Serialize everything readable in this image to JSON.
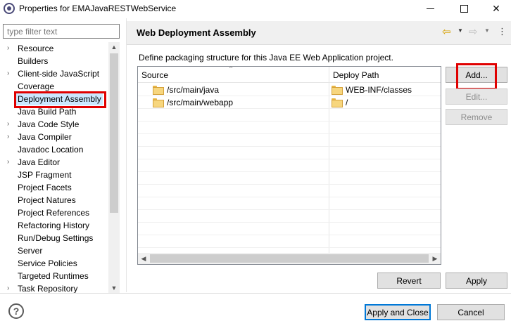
{
  "window": {
    "title": "Properties for EMAJavaRESTWebService",
    "icon": "eclipse-icon"
  },
  "filter": {
    "placeholder": "type filter text"
  },
  "tree": {
    "items": [
      {
        "label": "Resource",
        "expandable": true
      },
      {
        "label": "Builders",
        "expandable": false
      },
      {
        "label": "Client-side JavaScript",
        "expandable": true
      },
      {
        "label": "Coverage",
        "expandable": false
      },
      {
        "label": "Deployment Assembly",
        "expandable": false,
        "selected": true
      },
      {
        "label": "Java Build Path",
        "expandable": false
      },
      {
        "label": "Java Code Style",
        "expandable": true
      },
      {
        "label": "Java Compiler",
        "expandable": true
      },
      {
        "label": "Javadoc Location",
        "expandable": false
      },
      {
        "label": "Java Editor",
        "expandable": true
      },
      {
        "label": "JSP Fragment",
        "expandable": false
      },
      {
        "label": "Project Facets",
        "expandable": false
      },
      {
        "label": "Project Natures",
        "expandable": false
      },
      {
        "label": "Project References",
        "expandable": false
      },
      {
        "label": "Refactoring History",
        "expandable": false
      },
      {
        "label": "Run/Debug Settings",
        "expandable": false
      },
      {
        "label": "Server",
        "expandable": false
      },
      {
        "label": "Service Policies",
        "expandable": false
      },
      {
        "label": "Targeted Runtimes",
        "expandable": false
      },
      {
        "label": "Task Repository",
        "expandable": true
      }
    ]
  },
  "page": {
    "title": "Web Deployment Assembly",
    "description": "Define packaging structure for this Java EE Web Application project."
  },
  "table": {
    "columns": [
      "Source",
      "Deploy Path"
    ],
    "rows": [
      {
        "source": "/src/main/java",
        "deploy": "WEB-INF/classes"
      },
      {
        "source": "/src/main/webapp",
        "deploy": "/"
      }
    ]
  },
  "buttons": {
    "add": "Add...",
    "edit": "Edit...",
    "remove": "Remove",
    "revert": "Revert",
    "apply": "Apply",
    "apply_close": "Apply and Close",
    "cancel": "Cancel"
  },
  "colors": {
    "highlight": "#e00000",
    "selection": "#cce8ff",
    "accent": "#0078d7"
  }
}
